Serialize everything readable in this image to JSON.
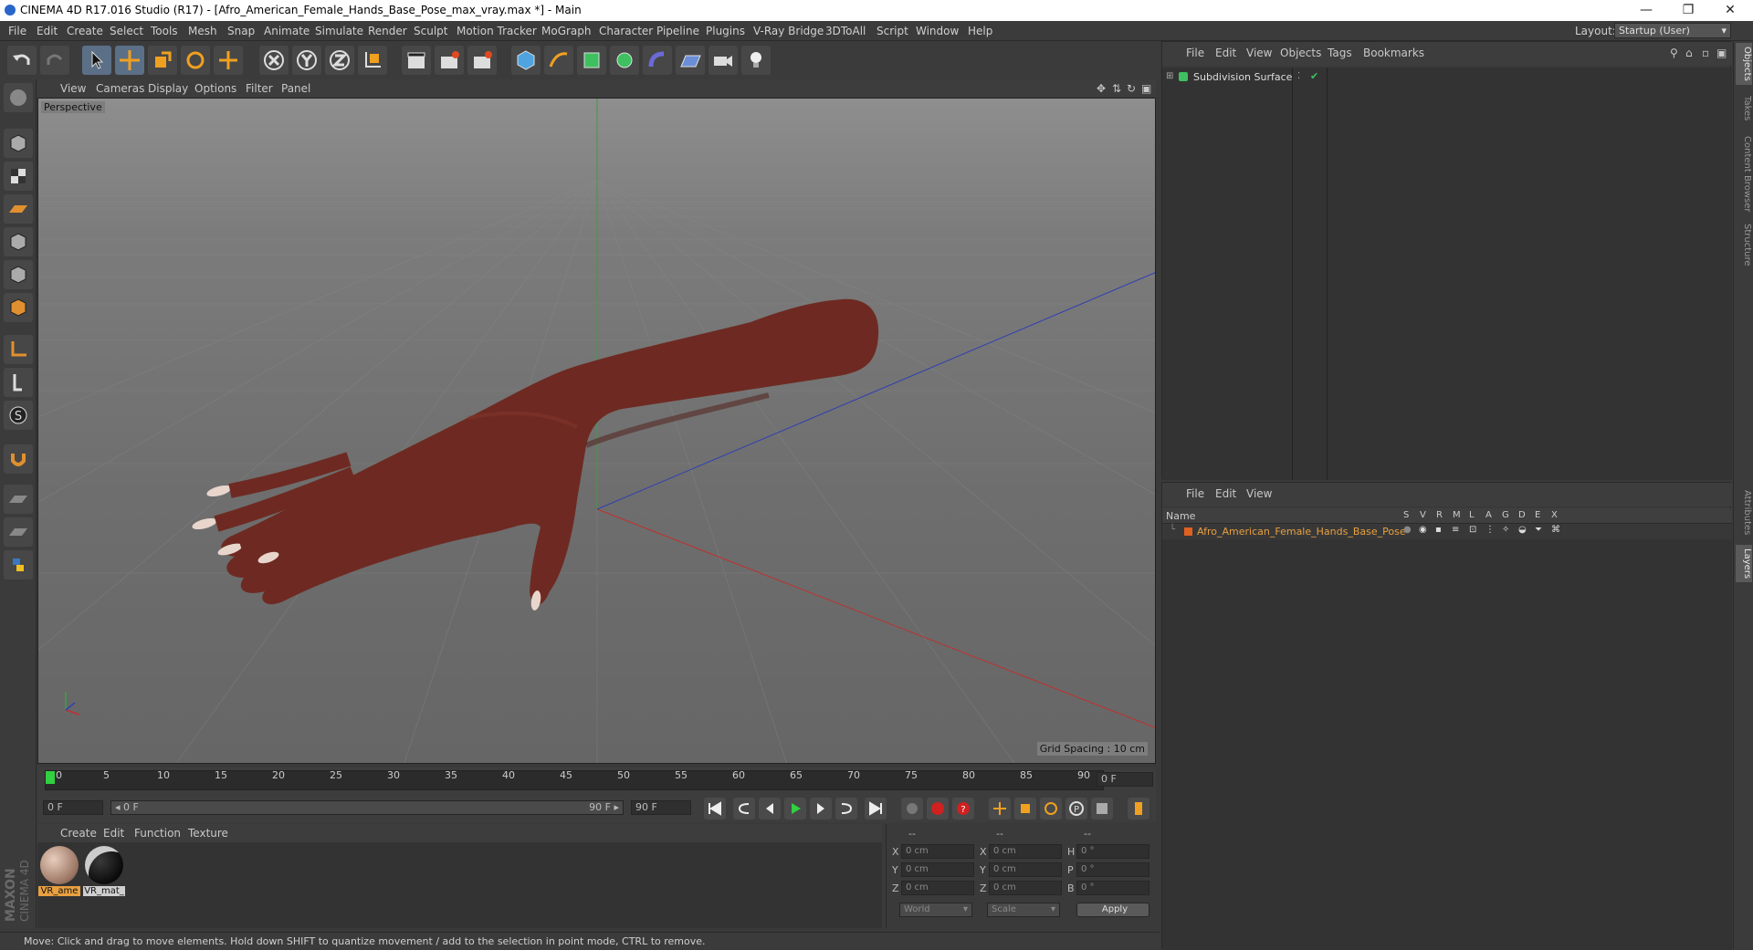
{
  "window": {
    "title": "CINEMA 4D R17.016 Studio (R17) - [Afro_American_Female_Hands_Base_Pose_max_vray.max *] - Main",
    "controls": {
      "minimize": "—",
      "maximize": "❐",
      "close": "✕"
    }
  },
  "menubar": {
    "items": [
      "File",
      "Edit",
      "Create",
      "Select",
      "Tools",
      "Mesh",
      "Snap",
      "Animate",
      "Simulate",
      "Render",
      "Sculpt",
      "Motion Tracker",
      "MoGraph",
      "Character",
      "Pipeline",
      "Plugins",
      "V-Ray Bridge",
      "3DToAll",
      "Script",
      "Window",
      "Help"
    ],
    "layout_label": "Layout:",
    "layout_value": "Startup (User)"
  },
  "viewport": {
    "menu": [
      "View",
      "Cameras",
      "Display",
      "Options",
      "Filter",
      "Panel"
    ],
    "camera_label": "Perspective",
    "grid_spacing": "Grid Spacing : 10 cm"
  },
  "timeline": {
    "ticks": [
      "0",
      "5",
      "10",
      "15",
      "20",
      "25",
      "30",
      "35",
      "40",
      "45",
      "50",
      "55",
      "60",
      "65",
      "70",
      "75",
      "80",
      "85",
      "90"
    ],
    "current_frame": "0 F"
  },
  "transport": {
    "start_field": "0 F",
    "range_start": "◂ 0 F",
    "range_end": "90 F ▸",
    "end_field": "90 F"
  },
  "material_manager": {
    "menu": [
      "Create",
      "Edit",
      "Function",
      "Texture"
    ],
    "materials": [
      {
        "label": "VR_ame",
        "color": "#c9a58e"
      },
      {
        "label": "VR_mat_",
        "color": "#1a1a1a"
      }
    ]
  },
  "coordinates": {
    "headers": [
      "--",
      "--",
      "--"
    ],
    "rows": [
      {
        "a": "X",
        "av": "0 cm",
        "b": "X",
        "bv": "0 cm",
        "c": "H",
        "cv": "0 °"
      },
      {
        "a": "Y",
        "av": "0 cm",
        "b": "Y",
        "bv": "0 cm",
        "c": "P",
        "cv": "0 °"
      },
      {
        "a": "Z",
        "av": "0 cm",
        "b": "Z",
        "bv": "0 cm",
        "c": "B",
        "cv": "0 °"
      }
    ],
    "mode1": "World",
    "mode2": "Scale",
    "apply": "Apply"
  },
  "object_manager": {
    "menu": [
      "File",
      "Edit",
      "View",
      "Objects",
      "Tags",
      "Bookmarks"
    ],
    "objects": [
      {
        "name": "Subdivision Surface"
      }
    ]
  },
  "layer_manager": {
    "menu": [
      "File",
      "Edit",
      "View"
    ],
    "columns": {
      "name": "Name",
      "flags": [
        "S",
        "V",
        "R",
        "M",
        "L",
        "A",
        "G",
        "D",
        "E",
        "X"
      ]
    },
    "layers": [
      {
        "name": "Afro_American_Female_Hands_Base_Pose"
      }
    ]
  },
  "right_tabs": [
    "Objects",
    "Takes",
    "Content Browser",
    "Structure",
    "Attributes",
    "Layers"
  ],
  "branding": {
    "maxon": "MAXON",
    "c4d": "CINEMA 4D"
  },
  "status": "Move: Click and drag to move elements. Hold down SHIFT to quantize movement / add to the selection in point mode, CTRL to remove.",
  "colors": {
    "accent": "#5b6f86",
    "layer_orange": "#e8a040",
    "skin": "#6e2a22"
  }
}
